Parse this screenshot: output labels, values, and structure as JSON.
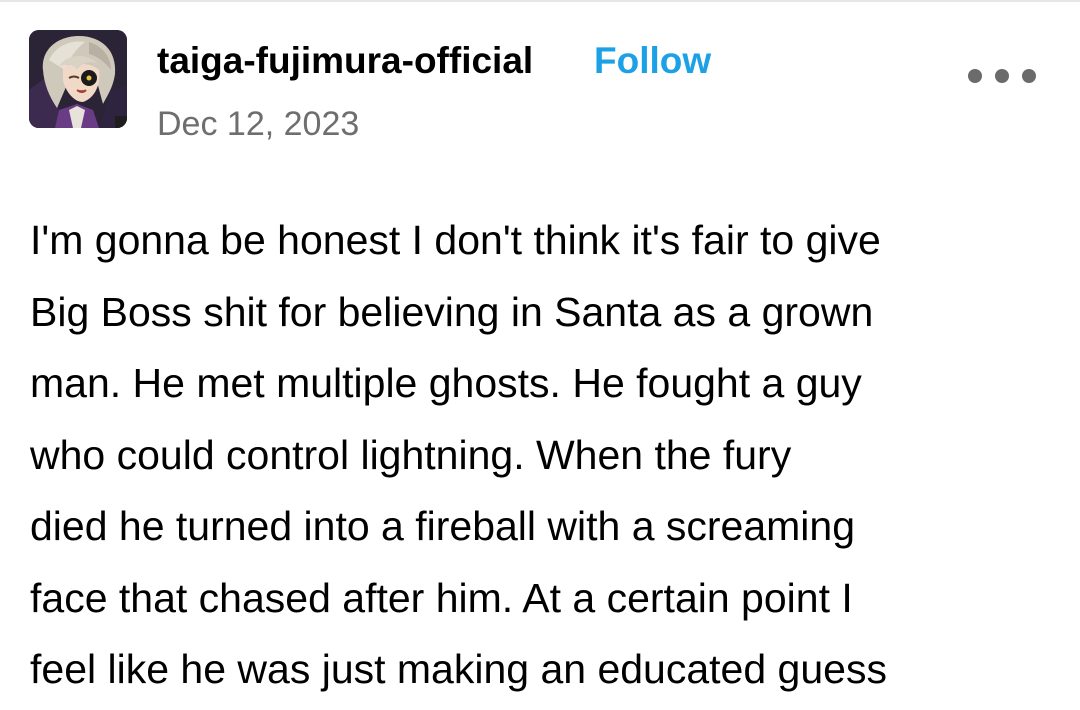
{
  "post": {
    "blog_name": "taiga-fujimura-official",
    "follow_label": "Follow",
    "date": "Dec 12, 2023",
    "more_icon": "ellipsis-icon",
    "lines": [
      "I'm gonna be honest I don't think it's fair to give",
      "Big Boss shit for believing in Santa as a grown",
      "man. He met multiple ghosts. He fought a guy",
      "who could control lightning. When the fury",
      "died he turned into a fireball with a screaming",
      "face that chased after him. At a certain point I",
      "feel like he was just making an educated guess"
    ]
  },
  "colors": {
    "follow": "#1da1e6",
    "date": "#6e6e6e",
    "text": "#000000",
    "icon": "#6b6b6b"
  }
}
